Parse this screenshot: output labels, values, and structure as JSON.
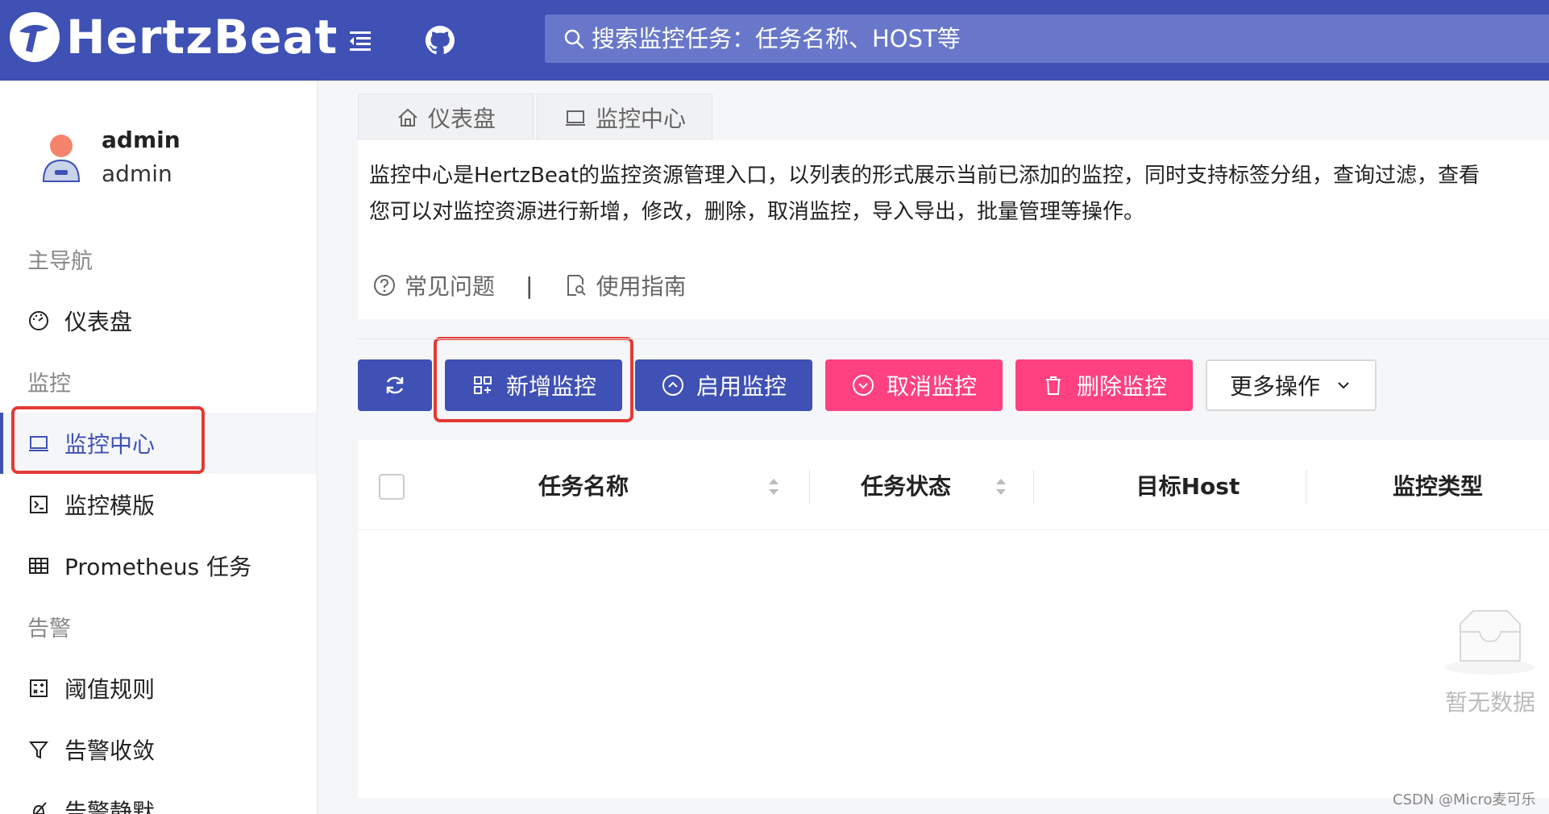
{
  "header": {
    "logo_text": "HertzBeat",
    "search_placeholder": "搜索监控任务：任务名称、HOST等"
  },
  "user": {
    "name": "admin",
    "role": "admin"
  },
  "sidebar": {
    "group_main": "主导航",
    "dashboard": "仪表盘",
    "group_monitor": "监控",
    "monitor_center": "监控中心",
    "monitor_template": "监控模版",
    "prometheus": "Prometheus 任务",
    "group_alert": "告警",
    "threshold": "阈值规则",
    "converge": "告警收敛",
    "silence": "告警静默"
  },
  "tabs": [
    {
      "label": "仪表盘"
    },
    {
      "label": "监控中心"
    }
  ],
  "info": {
    "line1": "监控中心是HertzBeat的监控资源管理入口，以列表的形式展示当前已添加的监控，同时支持标签分组，查询过滤，查看",
    "line2": "您可以对监控资源进行新增，修改，删除，取消监控，导入导出，批量管理等操作。",
    "faq": "常见问题",
    "separator": "|",
    "guide": "使用指南"
  },
  "toolbar": {
    "add": "新增监控",
    "enable": "启用监控",
    "cancel": "取消监控",
    "delete": "删除监控",
    "more": "更多操作"
  },
  "table": {
    "columns": [
      "任务名称",
      "任务状态",
      "目标Host",
      "监控类型"
    ],
    "empty_text": "暂无数据"
  },
  "watermark": "CSDN @Micro麦可乐",
  "colors": {
    "primary": "#3f51b5",
    "danger": "#ff4081",
    "highlight": "#e53935"
  }
}
